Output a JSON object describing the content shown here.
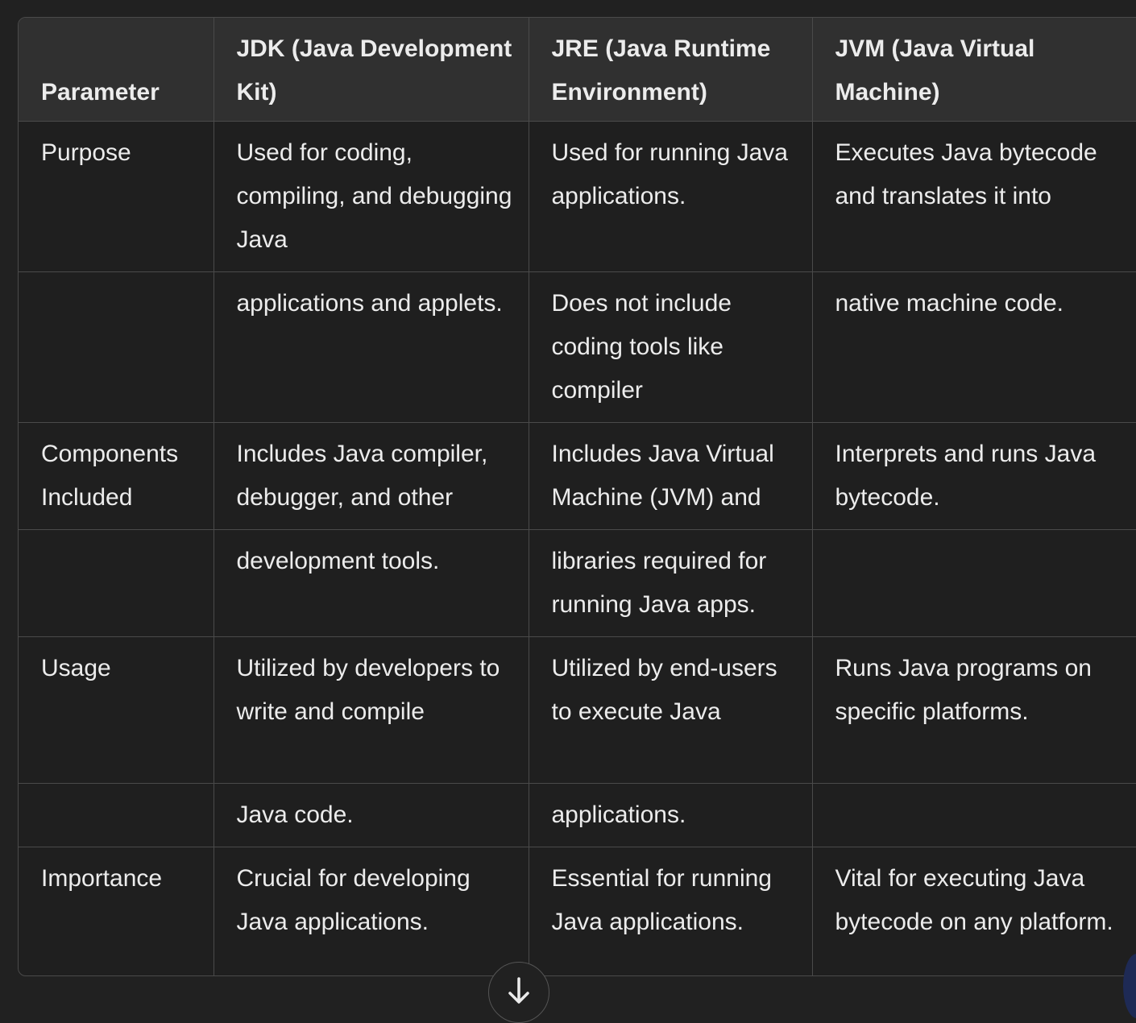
{
  "table": {
    "headers": [
      "Parameter",
      "JDK (Java Development Kit)",
      "JRE (Java Runtime Environment)",
      "JVM (Java Virtual Machine)"
    ],
    "rows": [
      [
        "Purpose",
        "Used for coding, compiling, and debugging Java",
        "Used for running Java applications.",
        "Executes Java bytecode and translates it into"
      ],
      [
        "",
        "applications and applets.",
        "Does not include coding tools like compiler",
        "native machine code."
      ],
      [
        "Components Included",
        "Includes Java compiler, debugger, and other",
        "Includes Java Virtual Machine (JVM) and",
        "Interprets and runs Java bytecode."
      ],
      [
        "",
        "development tools.",
        "libraries required for running Java apps.",
        ""
      ],
      [
        "Usage",
        "Utilized by developers to write and compile",
        "Utilized by end-users to execute Java",
        "Runs Java programs on specific platforms."
      ],
      [
        "",
        "Java code.",
        "applications.",
        ""
      ],
      [
        "Importance",
        "Crucial for developing Java applications.",
        "Essential for running Java applications.",
        "Vital for executing Java bytecode on any platform."
      ]
    ]
  },
  "icons": {
    "scroll_down": "arrow-down-icon"
  },
  "colors": {
    "background": "#212121",
    "header_bg": "#303030",
    "border": "#4a4a4a",
    "text": "#ececec"
  }
}
